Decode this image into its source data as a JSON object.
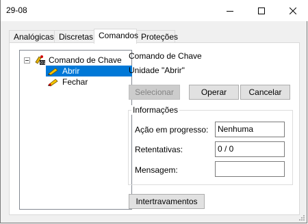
{
  "window": {
    "title": "29-08"
  },
  "tabs": [
    {
      "label": "Analógicas"
    },
    {
      "label": "Discretas"
    },
    {
      "label": "Comandos"
    },
    {
      "label": "Proteções"
    }
  ],
  "tree": {
    "root": {
      "label": "Comando de Chave",
      "expander": "⊟",
      "icon": "switch-command-icon"
    },
    "items": [
      {
        "label": "Abrir",
        "icon": "pencil-icon",
        "selected": true
      },
      {
        "label": "Fechar",
        "icon": "pencil-icon",
        "selected": false
      }
    ]
  },
  "details": {
    "heading": "Comando de Chave",
    "subheading": "Unidade \"Abrir\""
  },
  "buttons": {
    "select": "Selecionar",
    "operate": "Operar",
    "cancel": "Cancelar",
    "interlocks": "Intertravamentos"
  },
  "info": {
    "title": "Informações",
    "action_label": "Ação em progresso:",
    "action_value": "Nenhuma",
    "retries_label": "Retentativas:",
    "retries_value": "0 / 0",
    "message_label": "Mensagem:",
    "message_value": ""
  },
  "colors": {
    "selection": "#0078d7",
    "window_bg": "#f0f0f0"
  }
}
